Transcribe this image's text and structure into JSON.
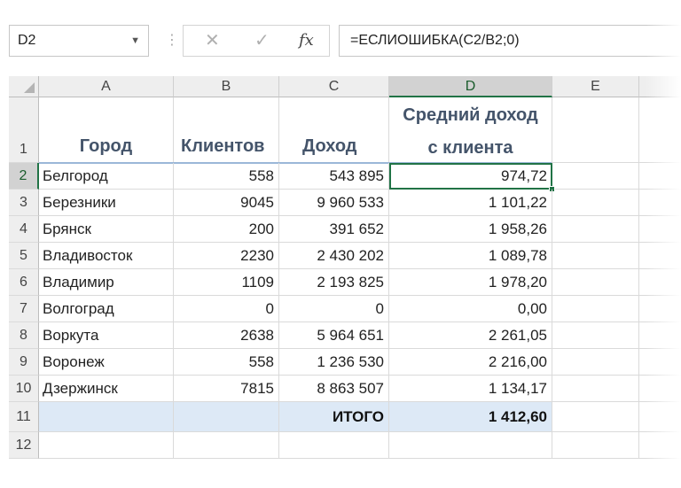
{
  "formula_bar": {
    "name_box": "D2",
    "cancel_symbol": "✕",
    "enter_symbol": "✓",
    "fx_symbol": "fx",
    "formula": "=ЕСЛИОШИБКА(C2/B2;0)"
  },
  "columns": [
    "A",
    "B",
    "C",
    "D",
    "E"
  ],
  "header_row": {
    "row_number": "1",
    "city": "Город",
    "clients": "Клиентов",
    "income": "Доход",
    "avg_line1": "Средний доход",
    "avg_line2": "с клиента"
  },
  "rows": [
    {
      "n": "2",
      "city": "Белгород",
      "clients": "558",
      "income": "543 895",
      "avg": "974,72"
    },
    {
      "n": "3",
      "city": "Березники",
      "clients": "9045",
      "income": "9 960 533",
      "avg": "1 101,22"
    },
    {
      "n": "4",
      "city": "Брянск",
      "clients": "200",
      "income": "391 652",
      "avg": "1 958,26"
    },
    {
      "n": "5",
      "city": "Владивосток",
      "clients": "2230",
      "income": "2 430 202",
      "avg": "1 089,78"
    },
    {
      "n": "6",
      "city": "Владимир",
      "clients": "1109",
      "income": "2 193 825",
      "avg": "1 978,20"
    },
    {
      "n": "7",
      "city": "Волгоград",
      "clients": "0",
      "income": "0",
      "avg": "0,00"
    },
    {
      "n": "8",
      "city": "Воркута",
      "clients": "2638",
      "income": "5 964 651",
      "avg": "2 261,05"
    },
    {
      "n": "9",
      "city": "Воронеж",
      "clients": "558",
      "income": "1 236 530",
      "avg": "2 216,00"
    },
    {
      "n": "10",
      "city": "Дзержинск",
      "clients": "7815",
      "income": "8 863 507",
      "avg": "1 134,17"
    }
  ],
  "total_row": {
    "n": "11",
    "label": "ИТОГО",
    "value": "1 412,60"
  },
  "empty_row": {
    "n": "12"
  },
  "colors": {
    "selection": "#217346",
    "header_text": "#44546a",
    "total_fill": "#dde9f6"
  }
}
